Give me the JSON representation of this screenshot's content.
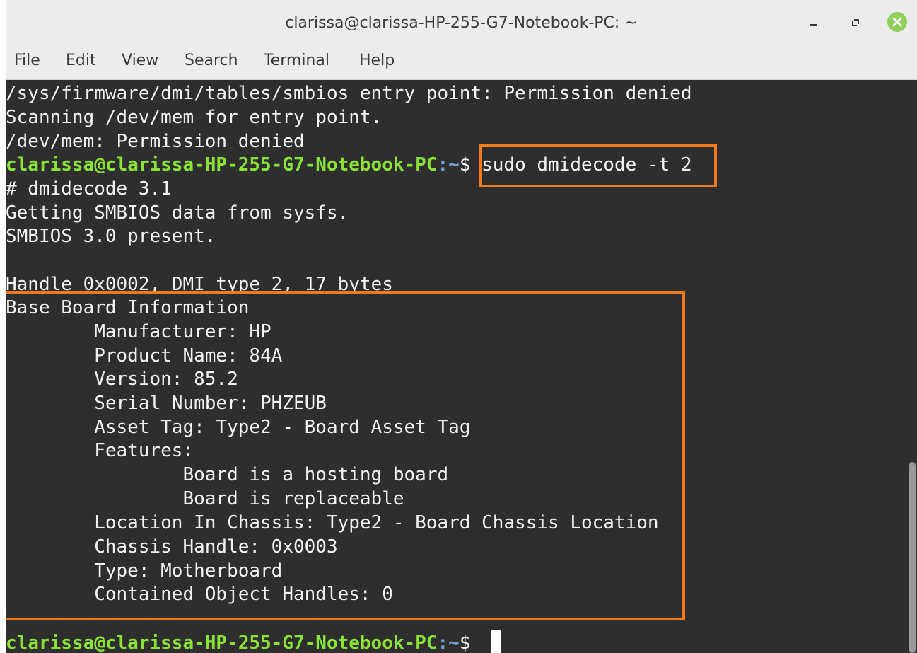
{
  "window": {
    "title": "clarissa@clarissa-HP-255-G7-Notebook-PC: ~",
    "controls": {
      "minimize": "minimize-icon",
      "maximize": "maximize-icon",
      "close": "close-icon",
      "close_color": "#8fcf5a"
    }
  },
  "menu": {
    "file": "File",
    "edit": "Edit",
    "view": "View",
    "search": "Search",
    "terminal": "Terminal",
    "help": "Help"
  },
  "prompt": {
    "user_host": "clarissa@clarissa-HP-255-G7-Notebook-PC",
    "path": ":~",
    "dollar": "$ "
  },
  "terminal": {
    "line0": "/sys/firmware/dmi/tables/smbios_entry_point: Permission denied",
    "line1": "Scanning /dev/mem for entry point.",
    "line2": "/dev/mem: Permission denied",
    "command": "sudo dmidecode -t 2",
    "line4": "# dmidecode 3.1",
    "line5": "Getting SMBIOS data from sysfs.",
    "line6": "SMBIOS 3.0 present.",
    "line7": "",
    "line8": "Handle 0x0002, DMI type 2, 17 bytes",
    "line9": "Base Board Information",
    "line10": "        Manufacturer: HP",
    "line11": "        Product Name: 84A",
    "line12": "        Version: 85.2",
    "line13": "        Serial Number: PHZEUB",
    "line14": "        Asset Tag: Type2 - Board Asset Tag",
    "line15": "        Features:",
    "line16": "                Board is a hosting board",
    "line17": "                Board is replaceable",
    "line18": "        Location In Chassis: Type2 - Board Chassis Location",
    "line19": "        Chassis Handle: 0x0003",
    "line20": "        Type: Motherboard",
    "line21": "        Contained Object Handles: 0"
  },
  "colors": {
    "terminal_bg": "#2e2e2e",
    "prompt_user": "#8ae234",
    "prompt_path": "#729fcf",
    "highlight": "#f07a1a"
  }
}
